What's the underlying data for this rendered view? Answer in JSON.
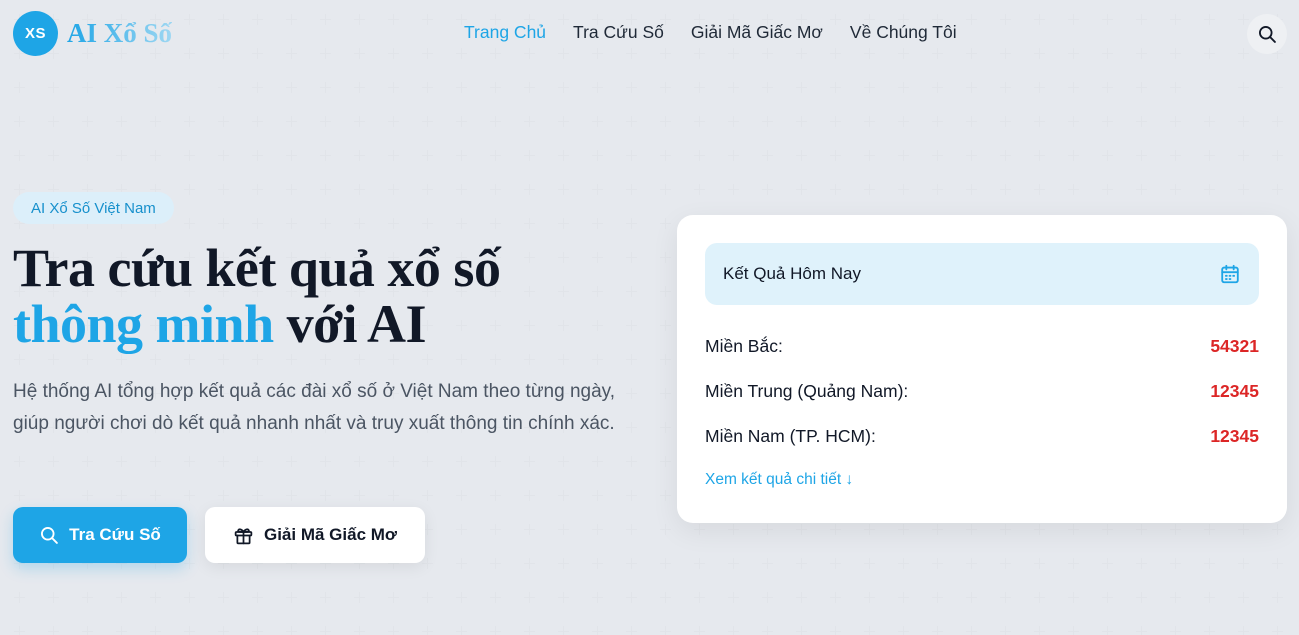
{
  "header": {
    "logo_badge": "XS",
    "logo_text": "AI Xổ Số",
    "nav": [
      {
        "label": "Trang Chủ",
        "active": true
      },
      {
        "label": "Tra Cứu Số",
        "active": false
      },
      {
        "label": "Giải Mã Giấc Mơ",
        "active": false
      },
      {
        "label": "Về Chúng Tôi",
        "active": false
      }
    ],
    "search_icon": "search-icon"
  },
  "hero": {
    "chip": "AI Xổ Số Việt Nam",
    "title_line1": "Tra cứu kết quả xổ số",
    "title_accent": "thông minh",
    "title_rest": " với AI",
    "description": "Hệ thống AI tổng hợp kết quả các đài xổ số ở Việt Nam theo từng ngày, giúp người chơi dò kết quả nhanh nhất và truy xuất thông tin chính xác.",
    "primary_button": "Tra Cứu Số",
    "primary_icon": "search-icon",
    "secondary_button": "Giải Mã Giấc Mơ",
    "secondary_icon": "gift-icon"
  },
  "results_card": {
    "title": "Kết Quả Hôm Nay",
    "title_icon": "calendar-icon",
    "rows": [
      {
        "label": "Miền Bắc:",
        "value": "54321"
      },
      {
        "label": "Miền Trung (Quảng Nam):",
        "value": "12345"
      },
      {
        "label": "Miền Nam (TP. HCM):",
        "value": "12345"
      }
    ],
    "detail_link": "Xem kết quả chi tiết ↓"
  },
  "colors": {
    "accent": "#1ea5e6",
    "value_red": "#dc2626",
    "chip_bg": "#dceffa"
  }
}
